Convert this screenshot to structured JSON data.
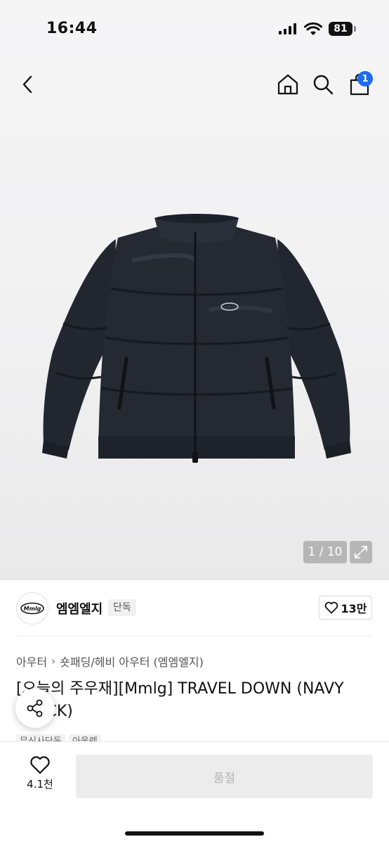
{
  "status_bar": {
    "time": "16:44",
    "battery_level": "81"
  },
  "nav": {
    "cart_badge": "1"
  },
  "image": {
    "counter": "1 / 10"
  },
  "brand": {
    "logo_text": "Mmlg",
    "name": "엠엠엘지",
    "tag": "단독",
    "likes": "13만"
  },
  "breadcrumb": {
    "category": "아우터",
    "subcategory": "숏패딩/헤비 아우터 (엠엠엘지)"
  },
  "product": {
    "title": "[오늘의 주우재][Mmlg] TRAVEL DOWN (NAVY BLACK)",
    "tags": [
      "무신사단독",
      "아울렛"
    ]
  },
  "bottom": {
    "wishlist_count": "4.1천",
    "purchase_label": "품절"
  },
  "colors": {
    "accent": "#1c6cf2",
    "jacket": "#22272f"
  },
  "icons": [
    "back-icon",
    "home-icon",
    "search-icon",
    "cart-icon",
    "expand-icon",
    "heart-icon",
    "share-icon"
  ]
}
